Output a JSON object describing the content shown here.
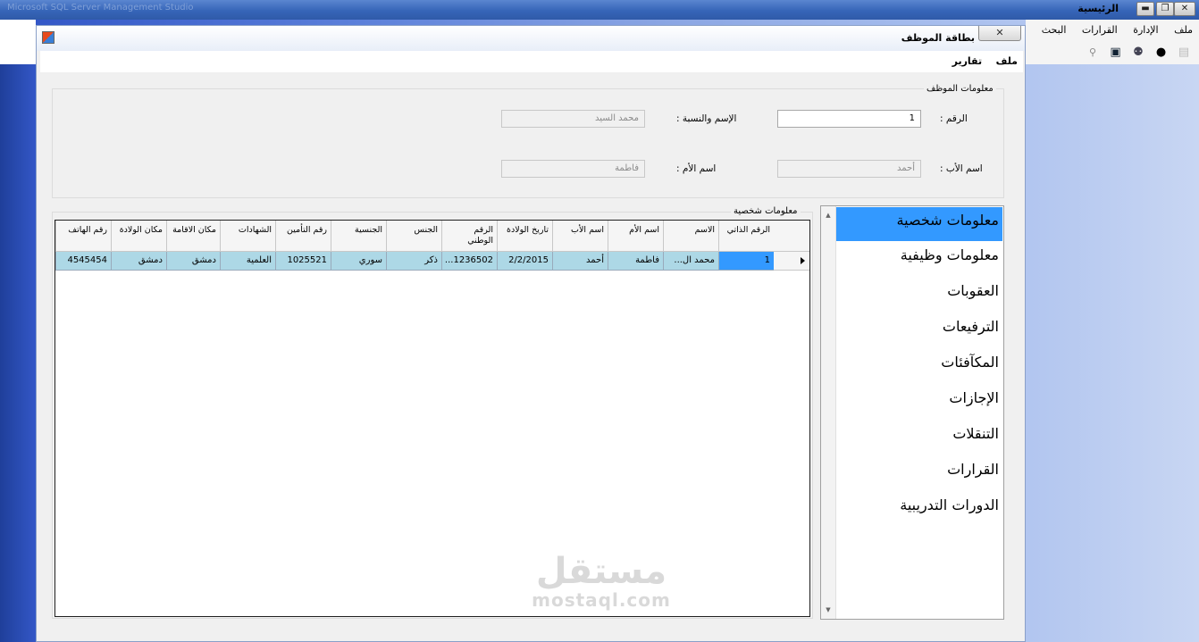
{
  "main_window": {
    "faded_title": "Microsoft SQL Server Management Studio",
    "title": "الرئيسية",
    "menu": [
      "ملف",
      "الإدارة",
      "القرارات",
      "البحث"
    ]
  },
  "card_window": {
    "title": "بطاقة الموظف",
    "menu": [
      "ملف",
      "تقارير"
    ]
  },
  "employee_info": {
    "legend": "معلومات الموظف",
    "number_label": "الرقم :",
    "number_value": "1",
    "name_label": "الإسم والنسبة :",
    "name_value": "محمد السيد",
    "father_label": "اسم الأب :",
    "father_value": "أحمد",
    "mother_label": "اسم الأم :",
    "mother_value": "فاطمة"
  },
  "personal_info": {
    "legend": "معلومات شخصية",
    "columns": [
      "الرقم الذاتي",
      "الاسم",
      "اسم الأم",
      "اسم الأب",
      "تاريخ الولادة",
      "الرقم الوطني",
      "الجنس",
      "الجنسية",
      "رقم التأمين",
      "الشهادات",
      "مكان الاقامة",
      "مكان الولادة",
      "رقم الهاتف"
    ],
    "rows": [
      [
        "1",
        "محمد ال...",
        "فاطمة",
        "أحمد",
        "2/2/2015",
        "1236502...",
        "ذكر",
        "سوري",
        "1025521",
        "العلمية",
        "دمشق",
        "دمشق",
        "4545454"
      ]
    ]
  },
  "side_list": {
    "items": [
      "معلومات شخصية",
      "معلومات وظيفية",
      "العقوبات",
      "الترفيعات",
      "المكآفئات",
      "الإجازات",
      "التنقلات",
      "القرارات",
      "الدورات التدريبية"
    ],
    "selected_index": 0
  },
  "watermark": {
    "arabic": "مستقل",
    "latin": "mostaql.com"
  }
}
